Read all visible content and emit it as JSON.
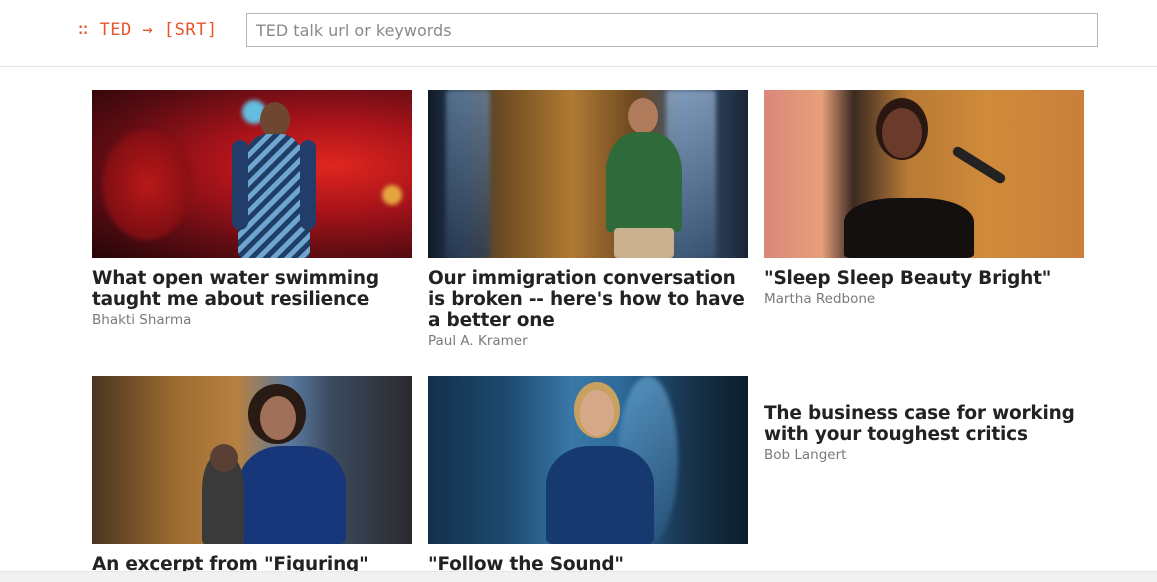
{
  "header": {
    "logo": "∷ TED → [SRT]",
    "search_placeholder": "TED talk url or keywords"
  },
  "talks": [
    {
      "title": "What open water swimming taught me about resilience",
      "speaker": "Bhakti Sharma",
      "thumbnail": "speaker-on-red-stage"
    },
    {
      "title": "Our immigration conversation is broken -- here's how to have a better one",
      "speaker": "Paul A. Kramer",
      "thumbnail": "speaker-on-amber-stage"
    },
    {
      "title": "\"Sleep Sleep Beauty Bright\"",
      "speaker": "Martha Redbone",
      "thumbnail": "singer-with-microphone"
    },
    {
      "title": "An excerpt from \"Figuring\"",
      "speaker": "",
      "thumbnail": "reader-with-microphone"
    },
    {
      "title": "\"Follow the Sound\"",
      "speaker": "",
      "thumbnail": "singer-on-blue-stage"
    },
    {
      "title": "The business case for working with your toughest critics",
      "speaker": "Bob Langert",
      "thumbnail": ""
    }
  ],
  "colors": {
    "accent": "#e8542a",
    "title_text": "#222222",
    "speaker_text": "#7a7a7a"
  }
}
